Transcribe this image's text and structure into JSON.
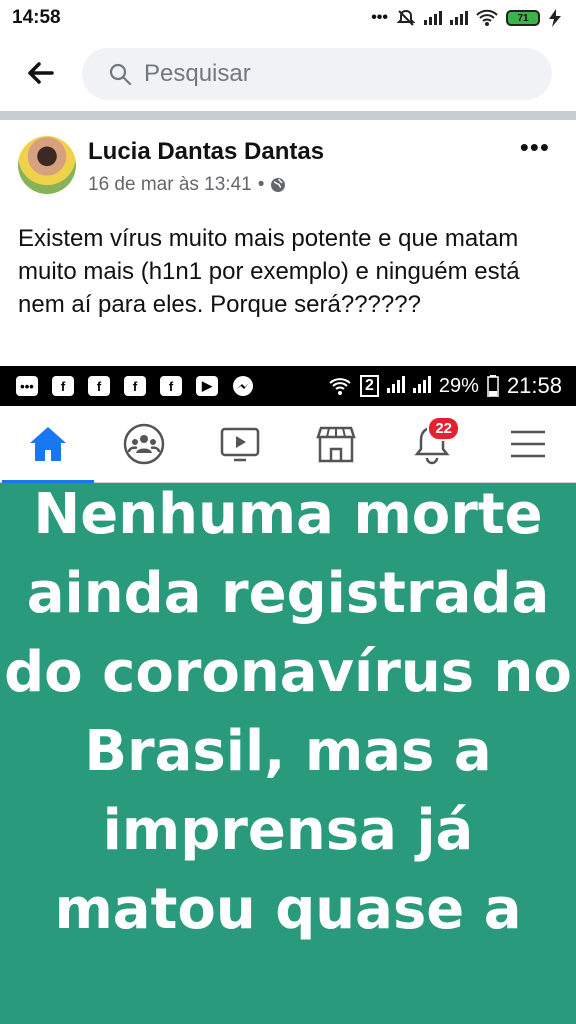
{
  "status_bar": {
    "time": "14:58",
    "dots": "•••",
    "battery": "71"
  },
  "search": {
    "placeholder": "Pesquisar"
  },
  "post": {
    "author": "Lucia Dantas Dantas",
    "timestamp": "16 de mar às 13:41",
    "separator": "•",
    "more_label": "•••",
    "text": "Existem vírus muito mais potente e que matam muito mais (h1n1 por exemplo) e ninguém está nem aí para eles. Porque será??????"
  },
  "embedded_screenshot": {
    "status_bar": {
      "app_icons": [
        "f",
        "f",
        "f",
        "f"
      ],
      "network": "2",
      "battery_percent": "29%",
      "time": "21:58"
    },
    "nav": {
      "notification_count": "22"
    },
    "image_text": "Nenhuma morte ainda registrada do coronavírus no Brasil, mas a imprensa já matou quase a"
  },
  "colors": {
    "panel_green": "#2a9a7d",
    "accent_blue": "#1877f2",
    "badge_red": "#e4212f"
  }
}
